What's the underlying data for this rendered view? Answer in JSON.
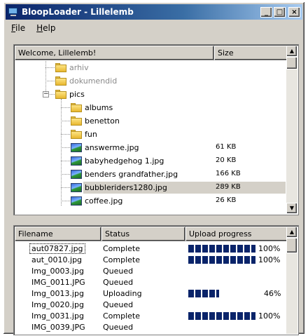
{
  "window": {
    "title": "BloopLoader - Lillelemb"
  },
  "titlebar_buttons": {
    "minimize": "_",
    "maximize": "□",
    "close": "×"
  },
  "menu": [
    {
      "label": "File"
    },
    {
      "label": "Help"
    }
  ],
  "tree": {
    "header_name": "Welcome, Lillelemb!",
    "header_size": "Size",
    "items": [
      {
        "name": "arhiv",
        "type": "folder",
        "dim": true
      },
      {
        "name": "dokumendid",
        "type": "folder",
        "dim": true
      },
      {
        "name": "pics",
        "type": "folder",
        "expanded": true
      },
      {
        "name": "albums",
        "type": "folder"
      },
      {
        "name": "benetton",
        "type": "folder"
      },
      {
        "name": "fun",
        "type": "folder"
      },
      {
        "name": "answerme.jpg",
        "type": "image",
        "size": "61 KB"
      },
      {
        "name": "babyhedgehog 1.jpg",
        "type": "image",
        "size": "20 KB"
      },
      {
        "name": "benders grandfather.jpg",
        "type": "image",
        "size": "166 KB"
      },
      {
        "name": "bubbleriders1280.jpg",
        "type": "image",
        "size": "289 KB",
        "selected": true
      },
      {
        "name": "coffee.jpg",
        "type": "image",
        "size": "26 KB"
      }
    ]
  },
  "uploads": {
    "headers": {
      "filename": "Filename",
      "status": "Status",
      "progress": "Upload progress"
    },
    "rows": [
      {
        "filename": "aut07827.jpg",
        "status": "Complete",
        "progress": 100,
        "pct_label": "100%",
        "focused": true
      },
      {
        "filename": "aut_0010.jpg",
        "status": "Complete",
        "progress": 100,
        "pct_label": "100%"
      },
      {
        "filename": "Img_0003.jpg",
        "status": "Queued"
      },
      {
        "filename": "IMG_0011.JPG",
        "status": "Queued"
      },
      {
        "filename": "Img_0013.jpg",
        "status": "Uploading",
        "progress": 46,
        "pct_label": "46%"
      },
      {
        "filename": "Img_0020.jpg",
        "status": "Queued"
      },
      {
        "filename": "Img_0031.jpg",
        "status": "Complete",
        "progress": 100,
        "pct_label": "100%"
      },
      {
        "filename": "IMG_0039.JPG",
        "status": "Queued"
      }
    ]
  },
  "icons": {
    "app": "monitor-icon",
    "folder": "folder-icon",
    "image": "image-file-icon",
    "expander": "expand-collapse-icon"
  }
}
